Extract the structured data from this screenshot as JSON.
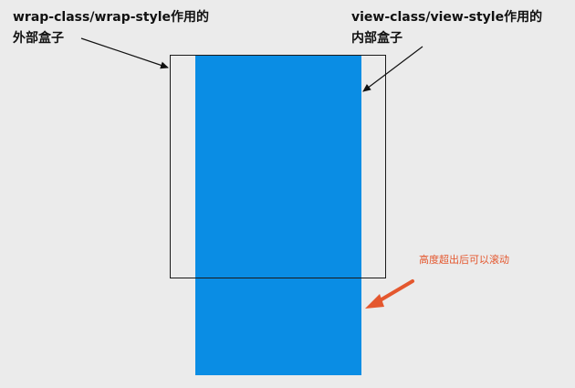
{
  "labels": {
    "outer": {
      "line1": "wrap-class/wrap-style作用的",
      "line2": "外部盒子"
    },
    "inner": {
      "line1": "view-class/view-style作用的",
      "line2": "内部盒子"
    },
    "scroll_note": "高度超出后可以滚动"
  },
  "colors": {
    "background": "#ebebeb",
    "inner_box": "#0a8de4",
    "outer_border": "#1a1a1a",
    "note_accent": "#e4572e"
  }
}
